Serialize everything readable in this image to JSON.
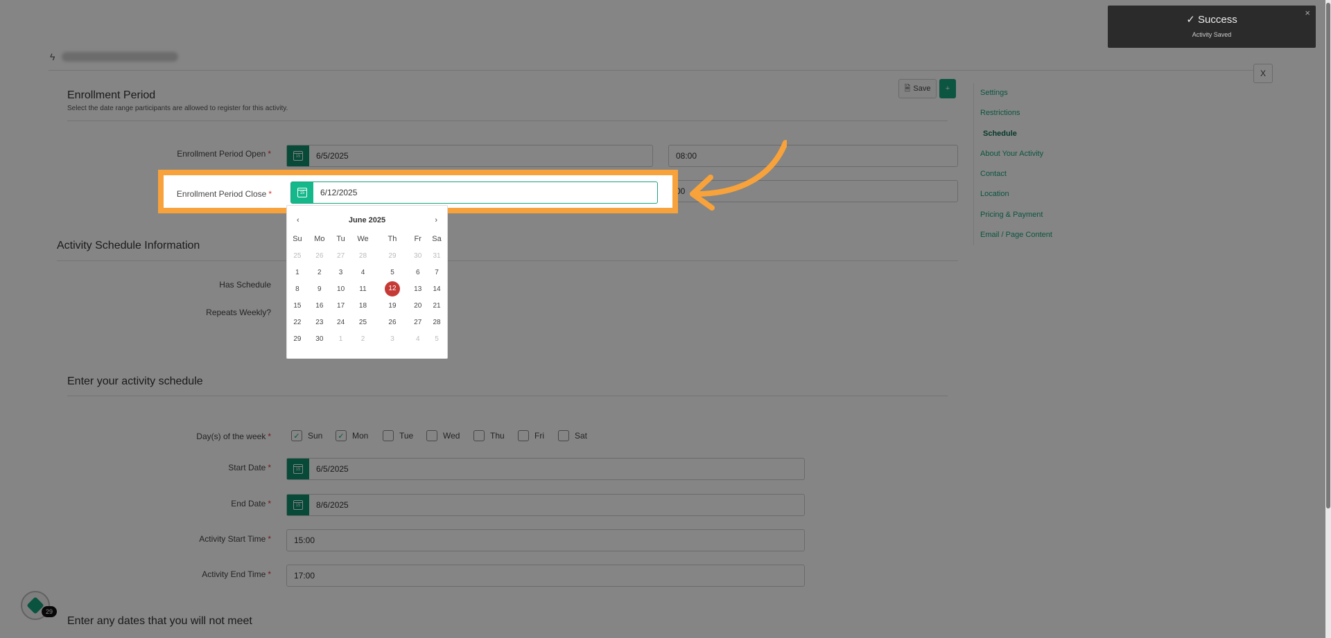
{
  "toast": {
    "title": "Success",
    "message": "Activity Saved",
    "close": "×"
  },
  "header": {
    "close_label": "X"
  },
  "toolbar": {
    "save_label": "Save",
    "plus_label": "+"
  },
  "side_nav": {
    "items": [
      {
        "label": "Settings"
      },
      {
        "label": "Restrictions"
      },
      {
        "label": "Schedule"
      },
      {
        "label": "About Your Activity"
      },
      {
        "label": "Contact"
      },
      {
        "label": "Location"
      },
      {
        "label": "Pricing & Payment"
      },
      {
        "label": "Email / Page Content"
      }
    ],
    "active": "Schedule"
  },
  "enrollment": {
    "title": "Enrollment Period",
    "subtitle": "Select the date range participants are allowed to register for this activity.",
    "open_label": "Enrollment Period Open",
    "open_date": "6/5/2025",
    "open_time": "08:00",
    "close_label": "Enrollment Period Close",
    "close_date": "6/12/2025",
    "close_time": "00"
  },
  "required_mark": "*",
  "calendar": {
    "month": "June 2025",
    "prev": "‹",
    "next": "›",
    "weekdays": [
      "Su",
      "Mo",
      "Tu",
      "We",
      "Th",
      "Fr",
      "Sa"
    ],
    "weeks": [
      [
        "25",
        "26",
        "27",
        "28",
        "29",
        "30",
        "31"
      ],
      [
        "1",
        "2",
        "3",
        "4",
        "5",
        "6",
        "7"
      ],
      [
        "8",
        "9",
        "10",
        "11",
        "12",
        "13",
        "14"
      ],
      [
        "15",
        "16",
        "17",
        "18",
        "19",
        "20",
        "21"
      ],
      [
        "22",
        "23",
        "24",
        "25",
        "26",
        "27",
        "28"
      ],
      [
        "29",
        "30",
        "1",
        "2",
        "3",
        "4",
        "5"
      ]
    ],
    "selected": "12"
  },
  "activity_schedule": {
    "title": "Activity Schedule Information",
    "has_schedule_label": "Has Schedule",
    "repeats_weekly_label": "Repeats Weekly?"
  },
  "schedule": {
    "title": "Enter your activity schedule",
    "days_label": "Day(s) of the week",
    "days": [
      {
        "label": "Sun",
        "checked": true
      },
      {
        "label": "Mon",
        "checked": true
      },
      {
        "label": "Tue",
        "checked": false
      },
      {
        "label": "Wed",
        "checked": false
      },
      {
        "label": "Thu",
        "checked": false
      },
      {
        "label": "Fri",
        "checked": false
      },
      {
        "label": "Sat",
        "checked": false
      }
    ],
    "start_date_label": "Start Date",
    "start_date": "6/5/2025",
    "end_date_label": "End Date",
    "end_date": "8/6/2025",
    "start_time_label": "Activity Start Time",
    "start_time": "15:00",
    "end_time_label": "Activity End Time",
    "end_time": "17:00"
  },
  "not_meet": {
    "title": "Enter any dates that you will not meet"
  },
  "fab": {
    "badge": "29"
  },
  "colors": {
    "accent": "#18a37c",
    "highlight": "#f8a23b",
    "selected_day": "#c63a36",
    "toast_bg": "#2b2b2b"
  }
}
